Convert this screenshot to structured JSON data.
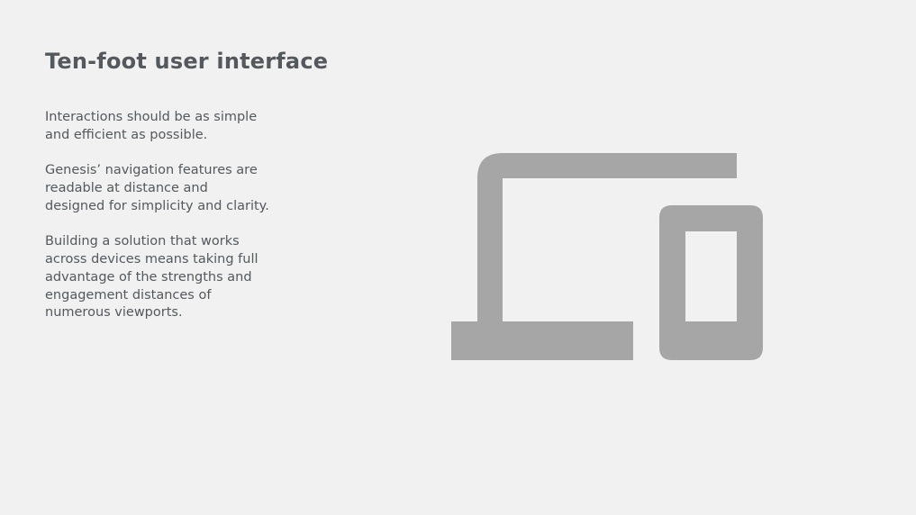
{
  "slide": {
    "title": "Ten-foot user interface",
    "paragraphs": [
      "Interactions should be as simple and efficient as possible.",
      "Genesis’ navigation features are readable at distance and designed for simplicity and clarity.",
      "Building a solution that works across devices means taking full advantage of the strengths and engagement distances of numerous viewports."
    ]
  },
  "illustration": {
    "icon": "devices-icon",
    "fill_color": "#a6a6a6",
    "background_color": "#f0f1f0"
  }
}
